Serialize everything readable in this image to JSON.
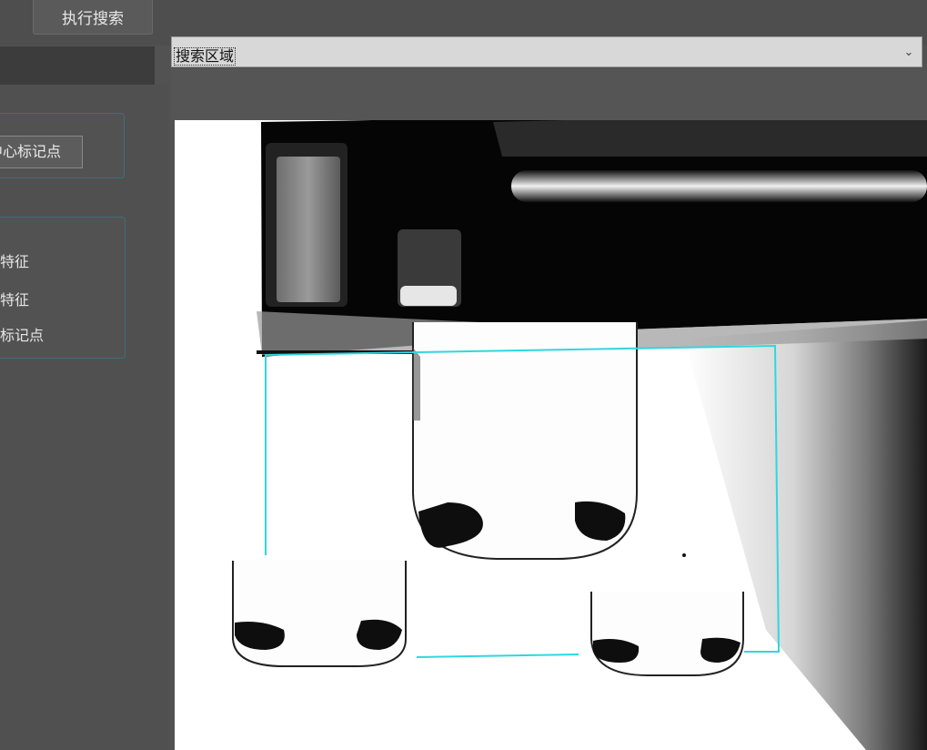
{
  "toolbar": {
    "run_search_label": "执行搜索"
  },
  "region_select": {
    "value": "搜索区域"
  },
  "mark_group": {
    "center_mark_button": "中心标记点"
  },
  "feature_group": {
    "options": [
      {
        "label": "粗特征"
      },
      {
        "label": "细特征"
      },
      {
        "label": "辅助标记点"
      }
    ]
  },
  "colors": {
    "roi_outline": "#2fd7e0",
    "group_border": "#3f6d7c"
  },
  "icons": {
    "dropdown": "chevron-down-icon"
  }
}
